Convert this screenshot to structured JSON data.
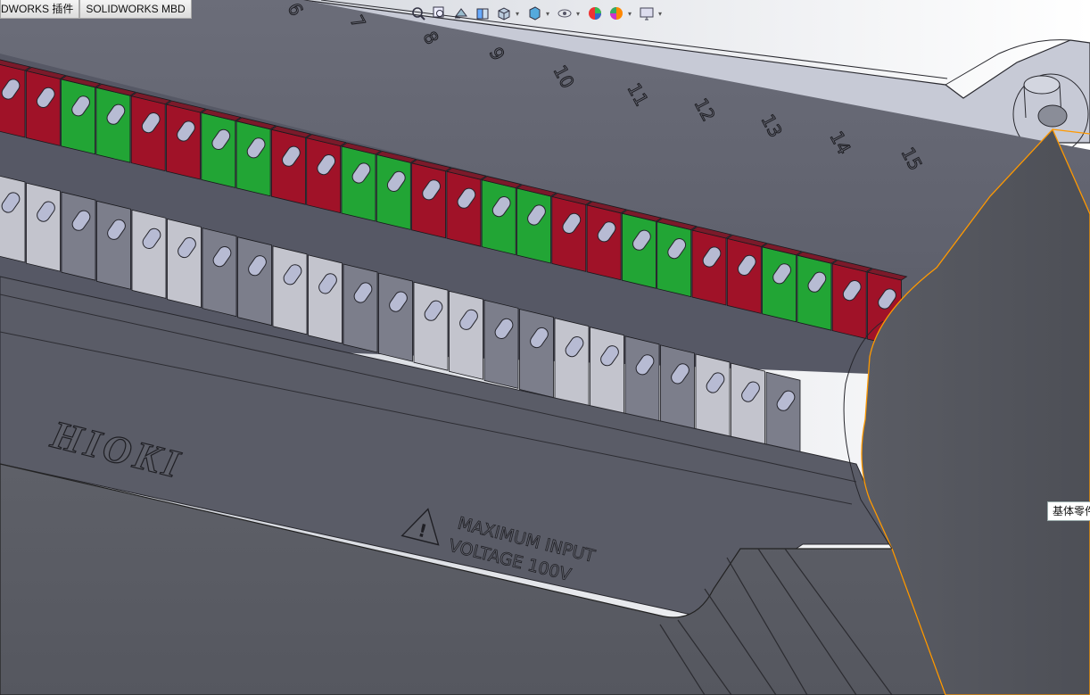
{
  "tabs": [
    {
      "id": "addins",
      "label": "DWORKS 插件"
    },
    {
      "id": "mbd",
      "label": "SOLIDWORKS MBD"
    }
  ],
  "heads_up_toolbar": {
    "items": [
      {
        "name": "zoom-to-fit-icon"
      },
      {
        "name": "zoom-to-area-icon"
      },
      {
        "name": "previous-view-icon"
      },
      {
        "name": "section-view-icon"
      },
      {
        "name": "view-orientation-icon"
      },
      {
        "name": "display-style-icon"
      },
      {
        "name": "hide-show-items-icon"
      },
      {
        "name": "edit-appearance-icon"
      },
      {
        "name": "apply-scene-icon"
      },
      {
        "name": "view-settings-icon"
      }
    ]
  },
  "model": {
    "channel_numbers": [
      "6",
      "7",
      "8",
      "9",
      "10",
      "11",
      "12",
      "13",
      "14",
      "15"
    ],
    "brand": "HIOKI",
    "warning_line1": "MAXIMUM INPUT",
    "warning_line2": "VOLTAGE 100V",
    "colors": {
      "terminal_red": "#a01228",
      "terminal_green": "#22a535",
      "terminal_light": "#c3c4cd",
      "terminal_dark": "#7c7e8b",
      "body": "#5d5f6a",
      "edge_highlight": "#ff9900"
    }
  },
  "tooltip": {
    "text": "基体零件"
  }
}
